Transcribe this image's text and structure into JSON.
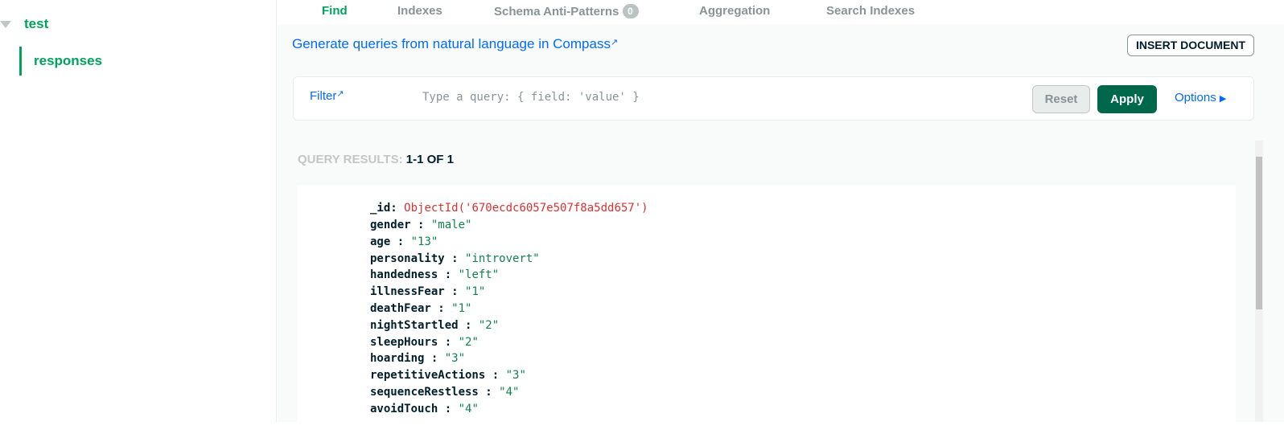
{
  "sidebar": {
    "database": "test",
    "collection": "responses"
  },
  "tabs": [
    {
      "label": "Find"
    },
    {
      "label": "Indexes"
    },
    {
      "label": "Schema Anti-Patterns",
      "badge": "0"
    },
    {
      "label": "Aggregation"
    },
    {
      "label": "Search Indexes"
    }
  ],
  "generate_link": "Generate queries from natural language in Compass",
  "insert_label": "INSERT DOCUMENT",
  "filter": {
    "label": "Filter",
    "placeholder": "Type a query: { field: 'value' }",
    "value": "",
    "reset": "Reset",
    "apply": "Apply",
    "options": "Options"
  },
  "results": {
    "label": "QUERY RESULTS:",
    "count": "1-1 OF 1"
  },
  "document": {
    "id_key": "_id",
    "id_value": "ObjectId('670ecdc6057e507f8a5dd657')",
    "fields": [
      {
        "k": "gender",
        "v": "\"male\""
      },
      {
        "k": "age",
        "v": "\"13\""
      },
      {
        "k": "personality",
        "v": "\"introvert\""
      },
      {
        "k": "handedness",
        "v": "\"left\""
      },
      {
        "k": "illnessFear",
        "v": "\"1\""
      },
      {
        "k": "deathFear",
        "v": "\"1\""
      },
      {
        "k": "nightStartled",
        "v": "\"2\""
      },
      {
        "k": "sleepHours",
        "v": "\"2\""
      },
      {
        "k": "hoarding",
        "v": "\"3\""
      },
      {
        "k": "repetitiveActions",
        "v": "\"3\""
      },
      {
        "k": "sequenceRestless",
        "v": "\"4\""
      },
      {
        "k": "avoidTouch",
        "v": "\"4\""
      }
    ]
  },
  "colors": {
    "accent": "#00a35c",
    "apply": "#00684a",
    "link": "#016bf8",
    "objectid": "#db3030",
    "string": "#12824d"
  }
}
